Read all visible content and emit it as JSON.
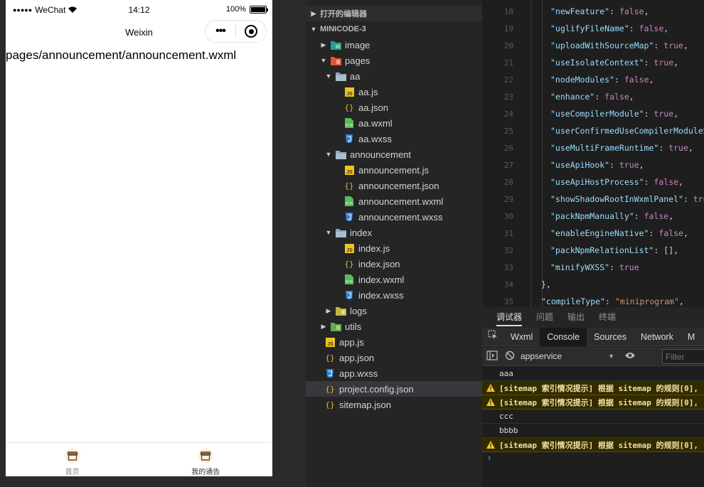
{
  "simulator": {
    "status": {
      "signal": "●●●●●",
      "carrier": "WeChat",
      "time": "14:12",
      "battery": "100%",
      "battery_level": 1.0
    },
    "nav_title": "Weixin",
    "capsule_more": "•••",
    "content_text": "pages/announcement/announcement.wxml",
    "tabbar": [
      {
        "label": "首页",
        "icon": "shop-icon",
        "active": false
      },
      {
        "label": "我的通告",
        "icon": "shop-icon",
        "active": true
      }
    ]
  },
  "explorer": {
    "sec_open_editors": "打开的编辑器",
    "sec_project": "MINICODE-3",
    "items": [
      {
        "name": "image",
        "type": "folder",
        "icon": "image-folder-icon",
        "expanded": false
      },
      {
        "name": "pages",
        "type": "folder",
        "icon": "pages-folder-icon",
        "expanded": true
      },
      {
        "name": "aa",
        "type": "folder",
        "icon": "folder-icon",
        "expanded": true
      },
      {
        "name": "aa.js",
        "type": "js",
        "icon": "js-file-icon"
      },
      {
        "name": "aa.json",
        "type": "json",
        "icon": "json-file-icon"
      },
      {
        "name": "aa.wxml",
        "type": "wxml",
        "icon": "wxml-file-icon"
      },
      {
        "name": "aa.wxss",
        "type": "wxss",
        "icon": "wxss-file-icon"
      },
      {
        "name": "announcement",
        "type": "folder",
        "icon": "folder-icon",
        "expanded": true
      },
      {
        "name": "announcement.js",
        "type": "js",
        "icon": "js-file-icon"
      },
      {
        "name": "announcement.json",
        "type": "json",
        "icon": "json-file-icon"
      },
      {
        "name": "announcement.wxml",
        "type": "wxml",
        "icon": "wxml-file-icon"
      },
      {
        "name": "announcement.wxss",
        "type": "wxss",
        "icon": "wxss-file-icon"
      },
      {
        "name": "index",
        "type": "folder",
        "icon": "folder-icon",
        "expanded": true
      },
      {
        "name": "index.js",
        "type": "js",
        "icon": "js-file-icon"
      },
      {
        "name": "index.json",
        "type": "json",
        "icon": "json-file-icon"
      },
      {
        "name": "index.wxml",
        "type": "wxml",
        "icon": "wxml-file-icon"
      },
      {
        "name": "index.wxss",
        "type": "wxss",
        "icon": "wxss-file-icon"
      },
      {
        "name": "logs",
        "type": "folder",
        "icon": "logs-folder-icon",
        "expanded": false
      },
      {
        "name": "utils",
        "type": "folder",
        "icon": "utils-folder-icon",
        "expanded": false
      },
      {
        "name": "app.js",
        "type": "js",
        "icon": "js-file-icon"
      },
      {
        "name": "app.json",
        "type": "json",
        "icon": "json-file-icon"
      },
      {
        "name": "app.wxss",
        "type": "wxss",
        "icon": "wxss-file-icon"
      },
      {
        "name": "project.config.json",
        "type": "json",
        "icon": "json-file-icon",
        "selected": true
      },
      {
        "name": "sitemap.json",
        "type": "json",
        "icon": "json-file-icon"
      }
    ]
  },
  "editor": {
    "lines": [
      {
        "n": "18",
        "key": "\"newFeature\"",
        "val": "false",
        "vt": "b",
        "tail": ","
      },
      {
        "n": "19",
        "key": "\"uglifyFileName\"",
        "val": "false",
        "vt": "b",
        "tail": ","
      },
      {
        "n": "20",
        "key": "\"uploadWithSourceMap\"",
        "val": "true",
        "vt": "b",
        "tail": ","
      },
      {
        "n": "21",
        "key": "\"useIsolateContext\"",
        "val": "true",
        "vt": "b",
        "tail": ","
      },
      {
        "n": "22",
        "key": "\"nodeModules\"",
        "val": "false",
        "vt": "b",
        "tail": ","
      },
      {
        "n": "23",
        "key": "\"enhance\"",
        "val": "false",
        "vt": "b",
        "tail": ","
      },
      {
        "n": "24",
        "key": "\"useCompilerModule\"",
        "val": "true",
        "vt": "b",
        "tail": ","
      },
      {
        "n": "25",
        "key": "\"userConfirmedUseCompilerModuleSw",
        "val": "",
        "vt": "b",
        "tail": ""
      },
      {
        "n": "26",
        "key": "\"useMultiFrameRuntime\"",
        "val": "true",
        "vt": "b",
        "tail": ","
      },
      {
        "n": "27",
        "key": "\"useApiHook\"",
        "val": "true",
        "vt": "b",
        "tail": ","
      },
      {
        "n": "28",
        "key": "\"useApiHostProcess\"",
        "val": "false",
        "vt": "b",
        "tail": ","
      },
      {
        "n": "29",
        "key": "\"showShadowRootInWxmlPanel\"",
        "val": "true",
        "vt": "b",
        "tail": ""
      },
      {
        "n": "30",
        "key": "\"packNpmManually\"",
        "val": "false",
        "vt": "b",
        "tail": ","
      },
      {
        "n": "31",
        "key": "\"enableEngineNative\"",
        "val": "false",
        "vt": "b",
        "tail": ","
      },
      {
        "n": "32",
        "key": "\"packNpmRelationList\"",
        "val": "[]",
        "vt": "p",
        "tail": ","
      },
      {
        "n": "33",
        "key": "\"minifyWXSS\"",
        "val": "true",
        "vt": "b",
        "tail": ""
      },
      {
        "n": "34",
        "key": "",
        "val": "},",
        "vt": "p",
        "tail": "",
        "indent": 1
      },
      {
        "n": "35",
        "key": "\"compileType\"",
        "val": "\"miniprogram\"",
        "vt": "s",
        "tail": ",",
        "indent": 1
      }
    ]
  },
  "debug": {
    "tabs": [
      "调试器",
      "问题",
      "输出",
      "终端"
    ],
    "devtools_tabs": [
      "Wxml",
      "Console",
      "Sources",
      "Network",
      "M"
    ],
    "context": "appservice",
    "filter_placeholder": "Filter",
    "console": [
      {
        "type": "log",
        "text": "aaa"
      },
      {
        "type": "warn",
        "text": "[sitemap 索引情况提示] 根据 sitemap 的规则[0],"
      },
      {
        "type": "warn",
        "text": "[sitemap 索引情况提示] 根据 sitemap 的规则[0],"
      },
      {
        "type": "log",
        "text": "ccc"
      },
      {
        "type": "log",
        "text": "bbbb"
      },
      {
        "type": "warn",
        "text": "[sitemap 索引情况提示] 根据 sitemap 的规则[0],"
      }
    ],
    "prompt": "›"
  },
  "colors": {
    "explorer_bg": "#252526",
    "editor_bg": "#1e1e1e",
    "json_key": "#9cdcfe",
    "json_string": "#ce9178",
    "json_bool": "#c586c0",
    "warn_bg": "#332b00"
  }
}
